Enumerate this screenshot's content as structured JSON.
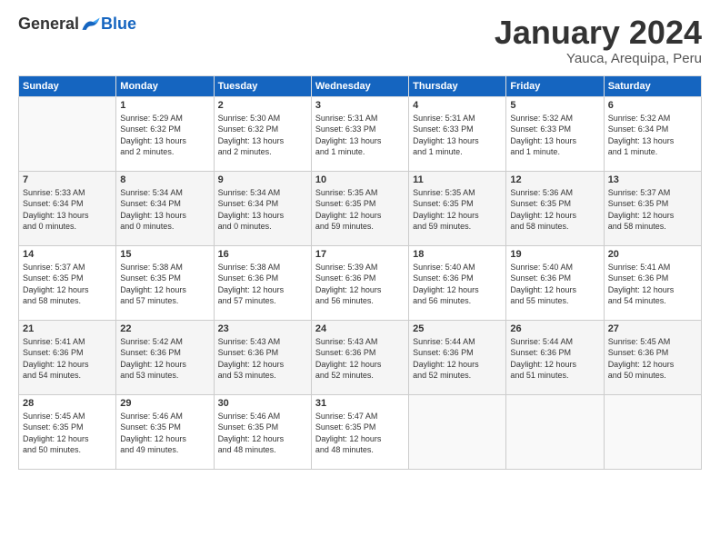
{
  "header": {
    "logo_general": "General",
    "logo_blue": "Blue",
    "month_title": "January 2024",
    "location": "Yauca, Arequipa, Peru"
  },
  "columns": [
    "Sunday",
    "Monday",
    "Tuesday",
    "Wednesday",
    "Thursday",
    "Friday",
    "Saturday"
  ],
  "weeks": [
    [
      {
        "day": "",
        "info": ""
      },
      {
        "day": "1",
        "info": "Sunrise: 5:29 AM\nSunset: 6:32 PM\nDaylight: 13 hours\nand 2 minutes."
      },
      {
        "day": "2",
        "info": "Sunrise: 5:30 AM\nSunset: 6:32 PM\nDaylight: 13 hours\nand 2 minutes."
      },
      {
        "day": "3",
        "info": "Sunrise: 5:31 AM\nSunset: 6:33 PM\nDaylight: 13 hours\nand 1 minute."
      },
      {
        "day": "4",
        "info": "Sunrise: 5:31 AM\nSunset: 6:33 PM\nDaylight: 13 hours\nand 1 minute."
      },
      {
        "day": "5",
        "info": "Sunrise: 5:32 AM\nSunset: 6:33 PM\nDaylight: 13 hours\nand 1 minute."
      },
      {
        "day": "6",
        "info": "Sunrise: 5:32 AM\nSunset: 6:34 PM\nDaylight: 13 hours\nand 1 minute."
      }
    ],
    [
      {
        "day": "7",
        "info": "Sunrise: 5:33 AM\nSunset: 6:34 PM\nDaylight: 13 hours\nand 0 minutes."
      },
      {
        "day": "8",
        "info": "Sunrise: 5:34 AM\nSunset: 6:34 PM\nDaylight: 13 hours\nand 0 minutes."
      },
      {
        "day": "9",
        "info": "Sunrise: 5:34 AM\nSunset: 6:34 PM\nDaylight: 13 hours\nand 0 minutes."
      },
      {
        "day": "10",
        "info": "Sunrise: 5:35 AM\nSunset: 6:35 PM\nDaylight: 12 hours\nand 59 minutes."
      },
      {
        "day": "11",
        "info": "Sunrise: 5:35 AM\nSunset: 6:35 PM\nDaylight: 12 hours\nand 59 minutes."
      },
      {
        "day": "12",
        "info": "Sunrise: 5:36 AM\nSunset: 6:35 PM\nDaylight: 12 hours\nand 58 minutes."
      },
      {
        "day": "13",
        "info": "Sunrise: 5:37 AM\nSunset: 6:35 PM\nDaylight: 12 hours\nand 58 minutes."
      }
    ],
    [
      {
        "day": "14",
        "info": "Sunrise: 5:37 AM\nSunset: 6:35 PM\nDaylight: 12 hours\nand 58 minutes."
      },
      {
        "day": "15",
        "info": "Sunrise: 5:38 AM\nSunset: 6:35 PM\nDaylight: 12 hours\nand 57 minutes."
      },
      {
        "day": "16",
        "info": "Sunrise: 5:38 AM\nSunset: 6:36 PM\nDaylight: 12 hours\nand 57 minutes."
      },
      {
        "day": "17",
        "info": "Sunrise: 5:39 AM\nSunset: 6:36 PM\nDaylight: 12 hours\nand 56 minutes."
      },
      {
        "day": "18",
        "info": "Sunrise: 5:40 AM\nSunset: 6:36 PM\nDaylight: 12 hours\nand 56 minutes."
      },
      {
        "day": "19",
        "info": "Sunrise: 5:40 AM\nSunset: 6:36 PM\nDaylight: 12 hours\nand 55 minutes."
      },
      {
        "day": "20",
        "info": "Sunrise: 5:41 AM\nSunset: 6:36 PM\nDaylight: 12 hours\nand 54 minutes."
      }
    ],
    [
      {
        "day": "21",
        "info": "Sunrise: 5:41 AM\nSunset: 6:36 PM\nDaylight: 12 hours\nand 54 minutes."
      },
      {
        "day": "22",
        "info": "Sunrise: 5:42 AM\nSunset: 6:36 PM\nDaylight: 12 hours\nand 53 minutes."
      },
      {
        "day": "23",
        "info": "Sunrise: 5:43 AM\nSunset: 6:36 PM\nDaylight: 12 hours\nand 53 minutes."
      },
      {
        "day": "24",
        "info": "Sunrise: 5:43 AM\nSunset: 6:36 PM\nDaylight: 12 hours\nand 52 minutes."
      },
      {
        "day": "25",
        "info": "Sunrise: 5:44 AM\nSunset: 6:36 PM\nDaylight: 12 hours\nand 52 minutes."
      },
      {
        "day": "26",
        "info": "Sunrise: 5:44 AM\nSunset: 6:36 PM\nDaylight: 12 hours\nand 51 minutes."
      },
      {
        "day": "27",
        "info": "Sunrise: 5:45 AM\nSunset: 6:36 PM\nDaylight: 12 hours\nand 50 minutes."
      }
    ],
    [
      {
        "day": "28",
        "info": "Sunrise: 5:45 AM\nSunset: 6:35 PM\nDaylight: 12 hours\nand 50 minutes."
      },
      {
        "day": "29",
        "info": "Sunrise: 5:46 AM\nSunset: 6:35 PM\nDaylight: 12 hours\nand 49 minutes."
      },
      {
        "day": "30",
        "info": "Sunrise: 5:46 AM\nSunset: 6:35 PM\nDaylight: 12 hours\nand 48 minutes."
      },
      {
        "day": "31",
        "info": "Sunrise: 5:47 AM\nSunset: 6:35 PM\nDaylight: 12 hours\nand 48 minutes."
      },
      {
        "day": "",
        "info": ""
      },
      {
        "day": "",
        "info": ""
      },
      {
        "day": "",
        "info": ""
      }
    ]
  ]
}
